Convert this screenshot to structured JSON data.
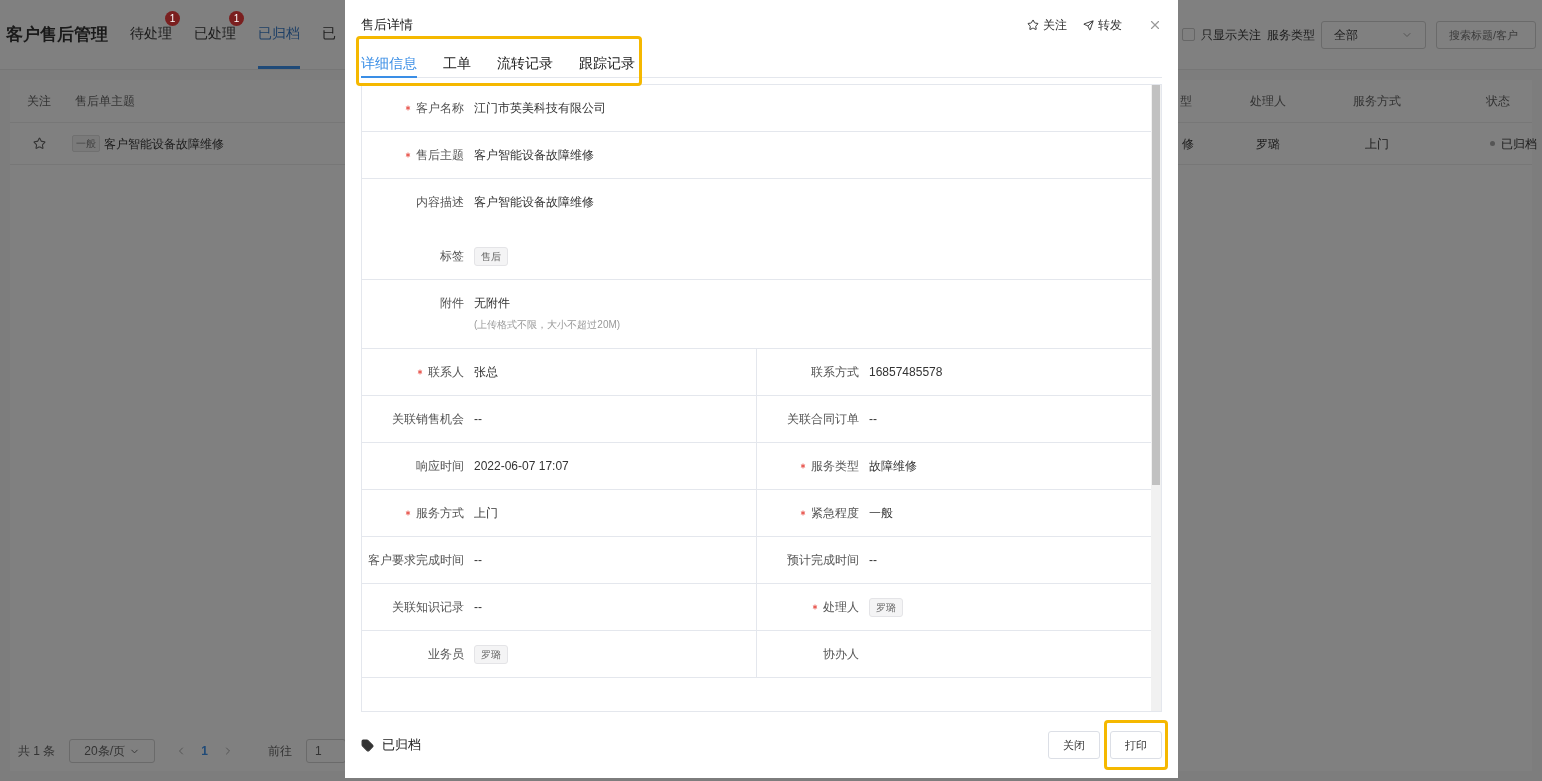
{
  "page": {
    "title": "客户售后管理",
    "tabs": [
      {
        "label": "待处理",
        "badge": "1",
        "selected": false
      },
      {
        "label": "已处理",
        "badge": "1",
        "selected": false
      },
      {
        "label": "已归档",
        "selected": true
      },
      {
        "label": "已",
        "selected": false
      }
    ],
    "filters": {
      "only_followed": {
        "label": "只显示关注",
        "checked": false
      },
      "service_type": {
        "label": "服务类型",
        "value": "全部"
      },
      "search": {
        "placeholder": "搜索标题/客户"
      }
    },
    "table": {
      "columns": [
        "关注",
        "售后单主题",
        "型",
        "处理人",
        "服务方式",
        "状态"
      ],
      "rows": [
        {
          "followed": false,
          "priority": "一般",
          "subject": "客户智能设备故障维修",
          "column_3": "修",
          "handler": "罗璐",
          "service_mode": "上门",
          "status": "已归档"
        }
      ]
    },
    "pagination": {
      "total": "共 1 条",
      "page_size": "20条/页",
      "pages": [
        {
          "label": "1",
          "selected": true
        }
      ],
      "goto_label": "前往",
      "goto_value": "1"
    }
  },
  "dialog": {
    "title": "售后详情",
    "actions": [
      {
        "kind": "follow",
        "label": "关注"
      },
      {
        "kind": "forward",
        "label": "转发"
      }
    ],
    "tabs": [
      {
        "label": "详细信息",
        "selected": true
      },
      {
        "label": "工单",
        "selected": false
      },
      {
        "label": "流转记录",
        "selected": false
      },
      {
        "label": "跟踪记录",
        "selected": false
      }
    ],
    "rows": [
      {
        "kind": "full",
        "items": [
          {
            "label": "客户名称",
            "required": true,
            "kind": "text",
            "value": "江门市英美科技有限公司"
          }
        ]
      },
      {
        "kind": "full",
        "items": [
          {
            "label": "售后主题",
            "required": true,
            "kind": "text",
            "value": "客户智能设备故障维修"
          }
        ]
      },
      {
        "kind": "full",
        "items": [
          {
            "label": "内容描述",
            "required": false,
            "kind": "textarea",
            "value": "客户智能设备故障维修"
          },
          {
            "label": "标签",
            "required": false,
            "kind": "tag",
            "value": "售后"
          }
        ]
      },
      {
        "kind": "full",
        "items": [
          {
            "label": "附件",
            "required": false,
            "kind": "text",
            "value": "无附件",
            "note": "(上传格式不限，大小不超过20M)"
          }
        ]
      },
      {
        "kind": "half",
        "items": [
          {
            "label": "联系人",
            "required": true,
            "kind": "text",
            "value": "张总"
          },
          {
            "label": "联系方式",
            "required": false,
            "kind": "text",
            "value": "16857485578"
          }
        ]
      },
      {
        "kind": "half",
        "items": [
          {
            "label": "关联销售机会",
            "required": false,
            "kind": "text",
            "value": "--"
          },
          {
            "label": "关联合同订单",
            "required": false,
            "kind": "text",
            "value": "--"
          }
        ]
      },
      {
        "kind": "half",
        "items": [
          {
            "label": "响应时间",
            "required": false,
            "kind": "text",
            "value": "2022-06-07 17:07"
          },
          {
            "label": "服务类型",
            "required": true,
            "kind": "text",
            "value": "故障维修"
          }
        ]
      },
      {
        "kind": "half",
        "items": [
          {
            "label": "服务方式",
            "required": true,
            "kind": "text",
            "value": "上门"
          },
          {
            "label": "紧急程度",
            "required": true,
            "kind": "text",
            "value": "一般"
          }
        ]
      },
      {
        "kind": "half",
        "items": [
          {
            "label": "客户要求完成时间",
            "required": false,
            "kind": "text",
            "value": "--"
          },
          {
            "label": "预计完成时间",
            "required": false,
            "kind": "text",
            "value": "--"
          }
        ]
      },
      {
        "kind": "half",
        "items": [
          {
            "label": "关联知识记录",
            "required": false,
            "kind": "text",
            "value": "--"
          },
          {
            "label": "处理人",
            "required": true,
            "kind": "tag",
            "value": "罗璐"
          }
        ]
      },
      {
        "kind": "half",
        "items": [
          {
            "label": "业务员",
            "required": false,
            "kind": "tag",
            "value": "罗璐"
          },
          {
            "label": "协办人",
            "required": false,
            "kind": "text"
          }
        ]
      }
    ],
    "footer": {
      "status": "已归档",
      "buttons": [
        {
          "label": "关闭",
          "highlighted": false
        },
        {
          "label": "打印",
          "highlighted": true
        }
      ]
    }
  }
}
